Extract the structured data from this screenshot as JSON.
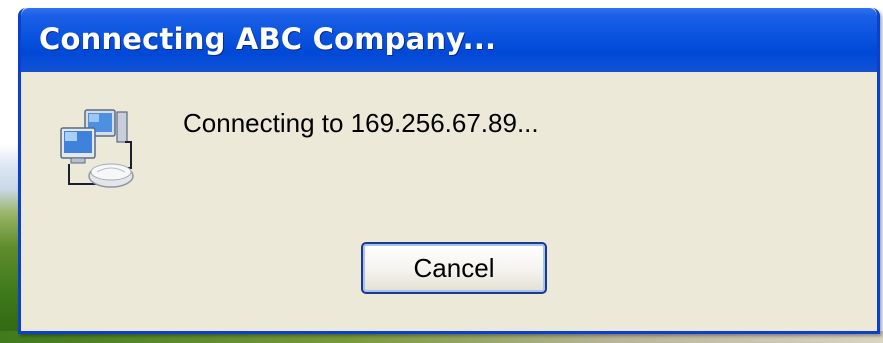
{
  "dialog": {
    "title": "Connecting ABC Company...",
    "message": "Connecting to 169.256.67.89...",
    "icon": "network-connection-icon",
    "cancel_label": "Cancel"
  },
  "colors": {
    "titlebar": "#0a53df",
    "border": "#0a3fd1",
    "body": "#ece9d8",
    "title_text": "#ffffff"
  }
}
